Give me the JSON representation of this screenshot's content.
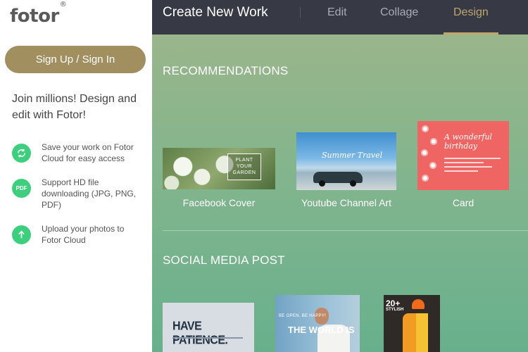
{
  "app": {
    "logo": "fotor",
    "logo_mark": "®"
  },
  "sidebar": {
    "signin_label": "Sign Up / Sign In",
    "pitch": "Join millions! Design and edit with Fotor!",
    "features": [
      {
        "icon": "sync-icon",
        "text": "Save your work on Fotor Cloud for easy access"
      },
      {
        "icon": "pdf-icon",
        "icon_text": "PDF",
        "text": "Support HD file downloading (JPG, PNG, PDF)"
      },
      {
        "icon": "upload-arrow-icon",
        "text": "Upload your photos to Fotor Cloud"
      }
    ]
  },
  "header": {
    "title": "Create New Work",
    "tabs": [
      {
        "label": "Edit",
        "active": false
      },
      {
        "label": "Collage",
        "active": false
      },
      {
        "label": "Design",
        "active": true
      }
    ]
  },
  "sections": {
    "recommendations": {
      "title": "RECOMMENDATIONS",
      "items": [
        {
          "label": "Facebook Cover",
          "thumb_text": "PLANT YOUR GARDEN"
        },
        {
          "label": "Youtube Channel Art",
          "thumb_text": "Summer Travel"
        },
        {
          "label": "Card",
          "thumb_text": "A wonderful birthday"
        }
      ]
    },
    "social": {
      "title": "SOCIAL MEDIA POST",
      "items": [
        {
          "thumb_text": "HAVE PATIENCE."
        },
        {
          "thumb_small": "BE OPEN. BE HAPPY!",
          "thumb_text": "THE WORLD IS"
        },
        {
          "thumb_num": "20+",
          "thumb_text": "STYLISH"
        }
      ]
    }
  },
  "colors": {
    "accent": "#c0a56d",
    "signin": "#a28f5f",
    "header": "#373a44",
    "feature_icon": "#3ecf7e"
  }
}
